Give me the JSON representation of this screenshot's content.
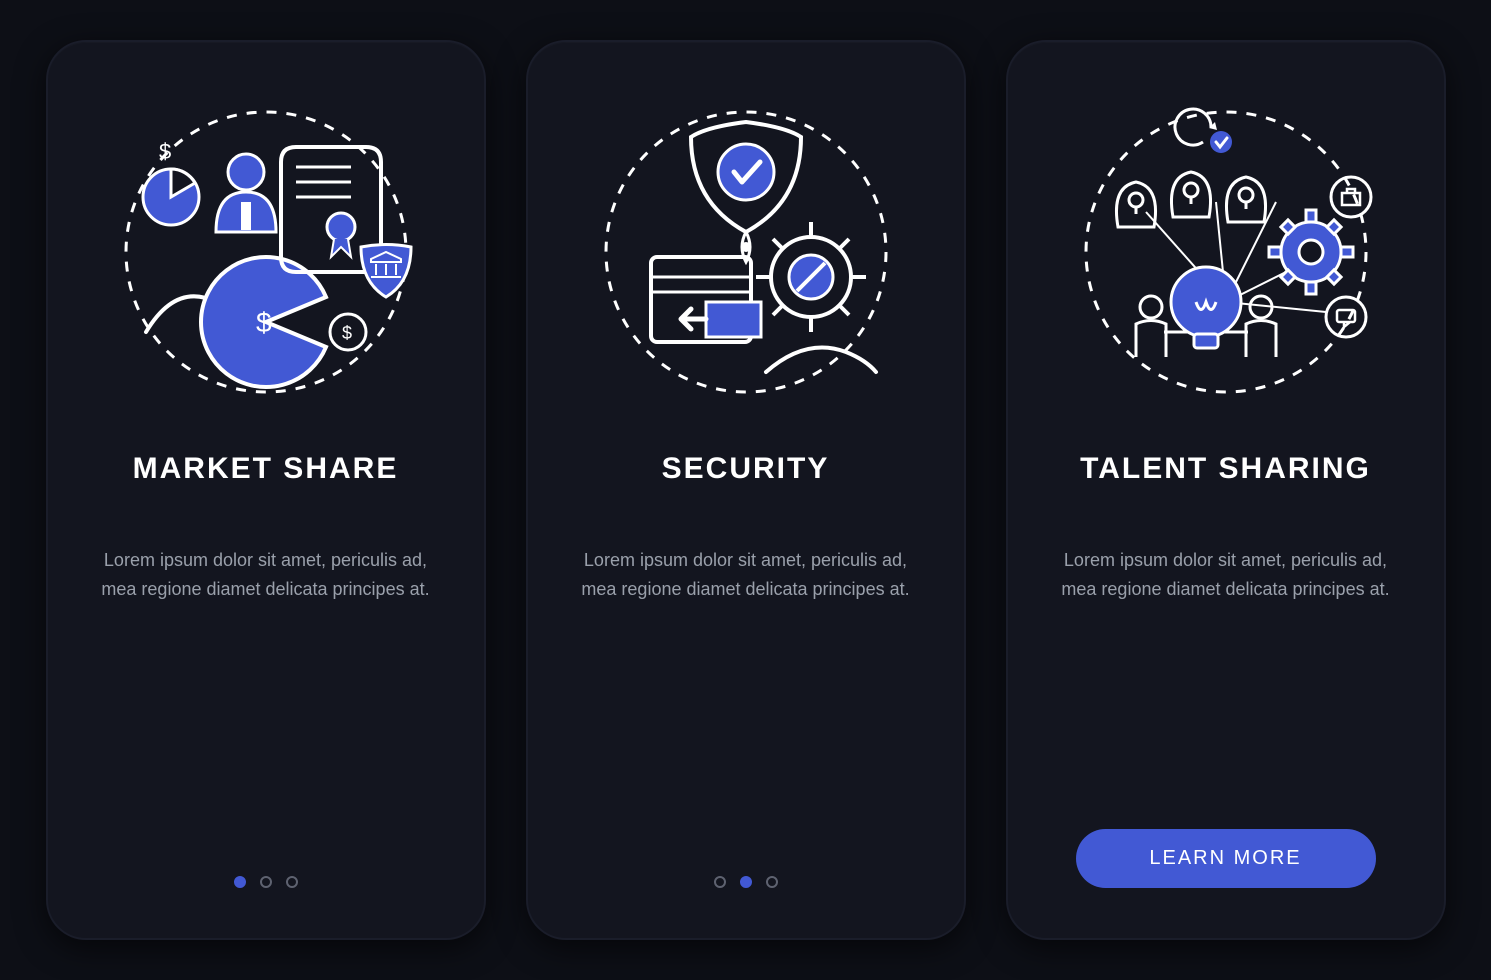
{
  "colors": {
    "accent": "#4259d4",
    "bg": "#0d0f16",
    "card": "#13151f",
    "text": "#ffffff",
    "muted": "#9aa0ab"
  },
  "cards": [
    {
      "icon": "market-share",
      "title": "MARKET SHARE",
      "desc": "Lorem ipsum dolor sit amet, periculis ad, mea regione diamet delicata principes at.",
      "activeDot": 0,
      "hasCta": false
    },
    {
      "icon": "security",
      "title": "SECURITY",
      "desc": "Lorem ipsum dolor sit amet, periculis ad, mea regione diamet delicata principes at.",
      "activeDot": 1,
      "hasCta": false
    },
    {
      "icon": "talent-sharing",
      "title": "TALENT SHARING",
      "desc": "Lorem ipsum dolor sit amet, periculis ad, mea regione diamet delicata principes at.",
      "activeDot": null,
      "hasCta": true
    }
  ],
  "cta_label": "LEARN MORE"
}
